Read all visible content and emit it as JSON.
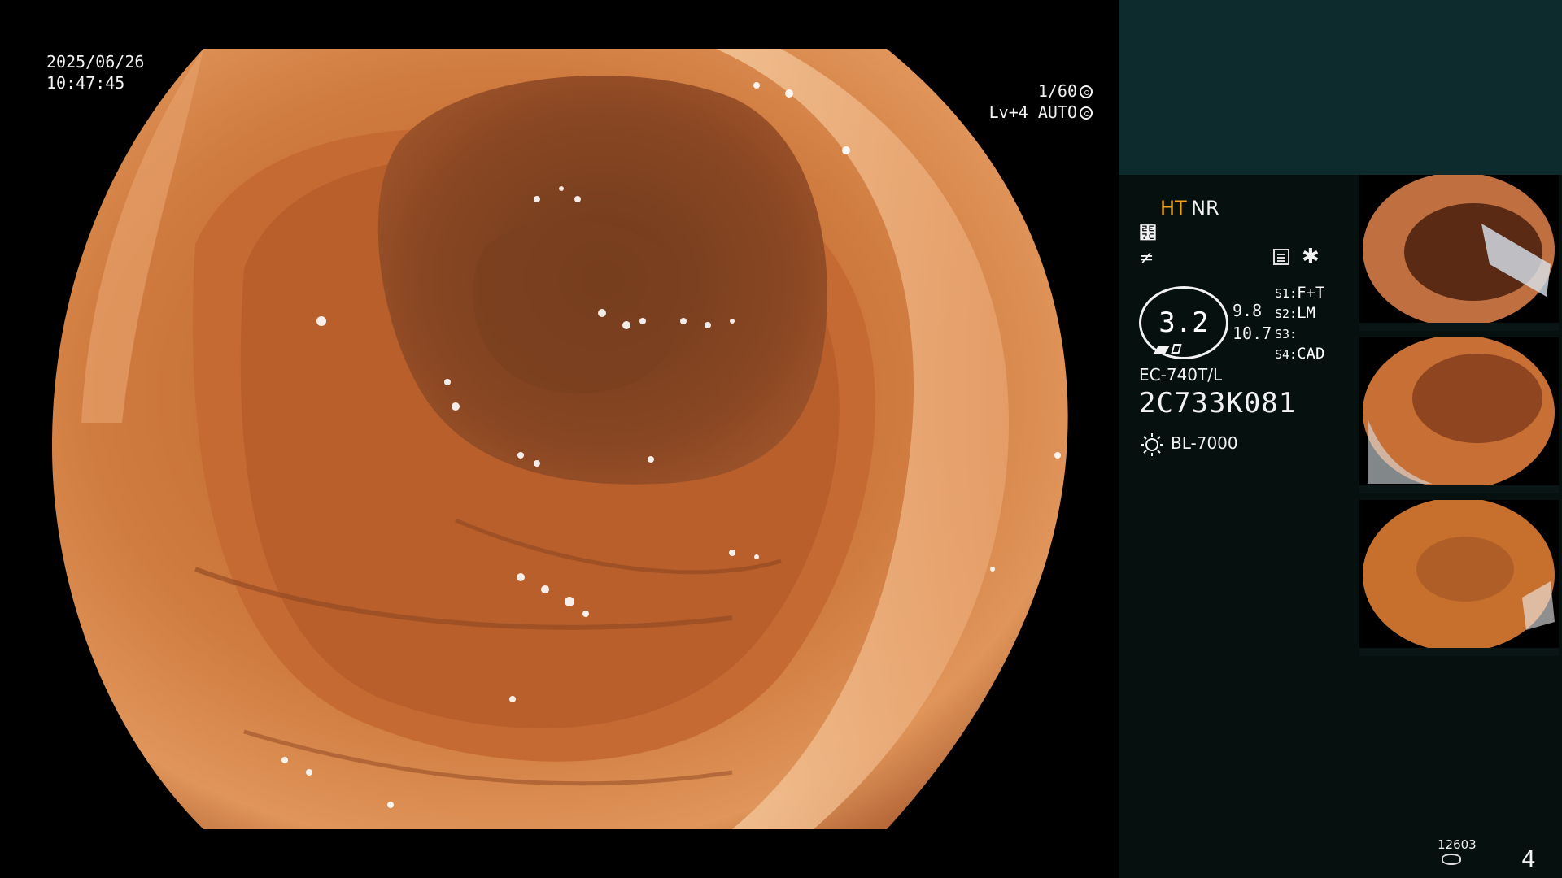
{
  "overlay": {
    "date": "2025/06/26",
    "time": "10:47:45",
    "shutter": "1/60",
    "level": "Lv+4 AUTO"
  },
  "panel": {
    "ht": "HT",
    "nr": "NR",
    "enhance_icon": "⹼",
    "filter_icon": "≠",
    "asterisk": "✱",
    "zoom_value": "3.2",
    "value_a": "9.8",
    "value_b": "10.7",
    "settings": [
      {
        "key": "S1:",
        "value": "F+T"
      },
      {
        "key": "S2:",
        "value": "LM"
      },
      {
        "key": "S3:",
        "value": ""
      },
      {
        "key": "S4:",
        "value": "CAD"
      }
    ],
    "model": "EC-740T/L",
    "serial": "2C733K081",
    "light_source": "BL-7000",
    "record_count": "12603",
    "page": "4"
  },
  "colors": {
    "panel_top": "#0d2a2c",
    "panel_bg": "#06100f",
    "ht_color": "#f0a21a",
    "tissue": "#c8692f"
  },
  "icons": [
    "shutter-icon",
    "auto-iris-icon",
    "enhance-icon",
    "filter-icon",
    "record-icon",
    "asterisk-icon",
    "light-source-icon",
    "disk-icon"
  ]
}
